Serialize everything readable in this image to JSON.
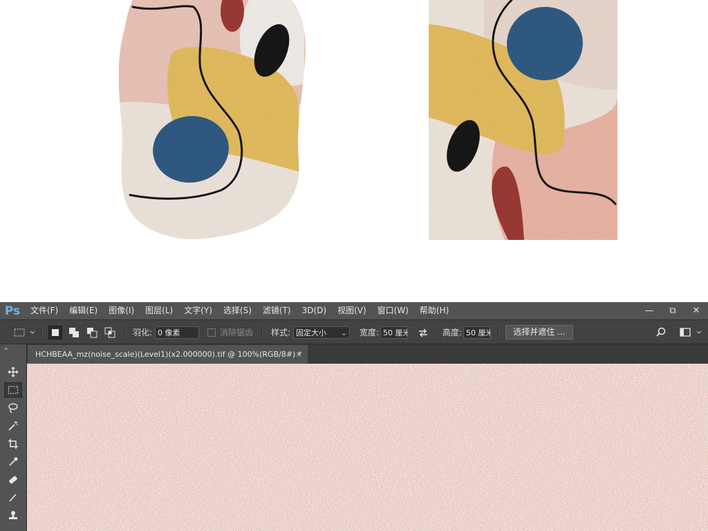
{
  "menubar": {
    "logo": "Ps",
    "items": [
      "文件(F)",
      "编辑(E)",
      "图像(I)",
      "图层(L)",
      "文字(Y)",
      "选择(S)",
      "滤镜(T)",
      "3D(D)",
      "视图(V)",
      "窗口(W)",
      "帮助(H)"
    ],
    "window_controls": [
      "—",
      "⧉",
      "✕"
    ]
  },
  "options": {
    "feather_label": "羽化:",
    "feather_value": "0 像素",
    "antialias_label": "消除锯齿",
    "style_label": "样式:",
    "style_value": "固定大小",
    "width_label": "宽度:",
    "width_value": "50 厘米",
    "height_label": "高度:",
    "height_value": "50 厘米",
    "select_mask_button": "选择并遮住 ..."
  },
  "document": {
    "tab_title": "HCHBEAA_mz(noise_scale)(Level1)(x2.000000).tif @ 100%(RGB/8#) *",
    "tab_close": "×"
  },
  "tools": [
    "move-tool",
    "rect-marquee-tool",
    "lasso-tool",
    "magic-wand-tool",
    "crop-tool",
    "eyedropper-tool",
    "healing-brush-tool",
    "brush-tool",
    "clone-stamp-tool"
  ],
  "colors": {
    "accent": "#6fb1e6",
    "panel": "#535353",
    "canvas_pink": "#dba596",
    "rug_blue": "#2f5a82",
    "rug_yellow": "#e2bb5e",
    "rug_red": "#9a3a33"
  }
}
